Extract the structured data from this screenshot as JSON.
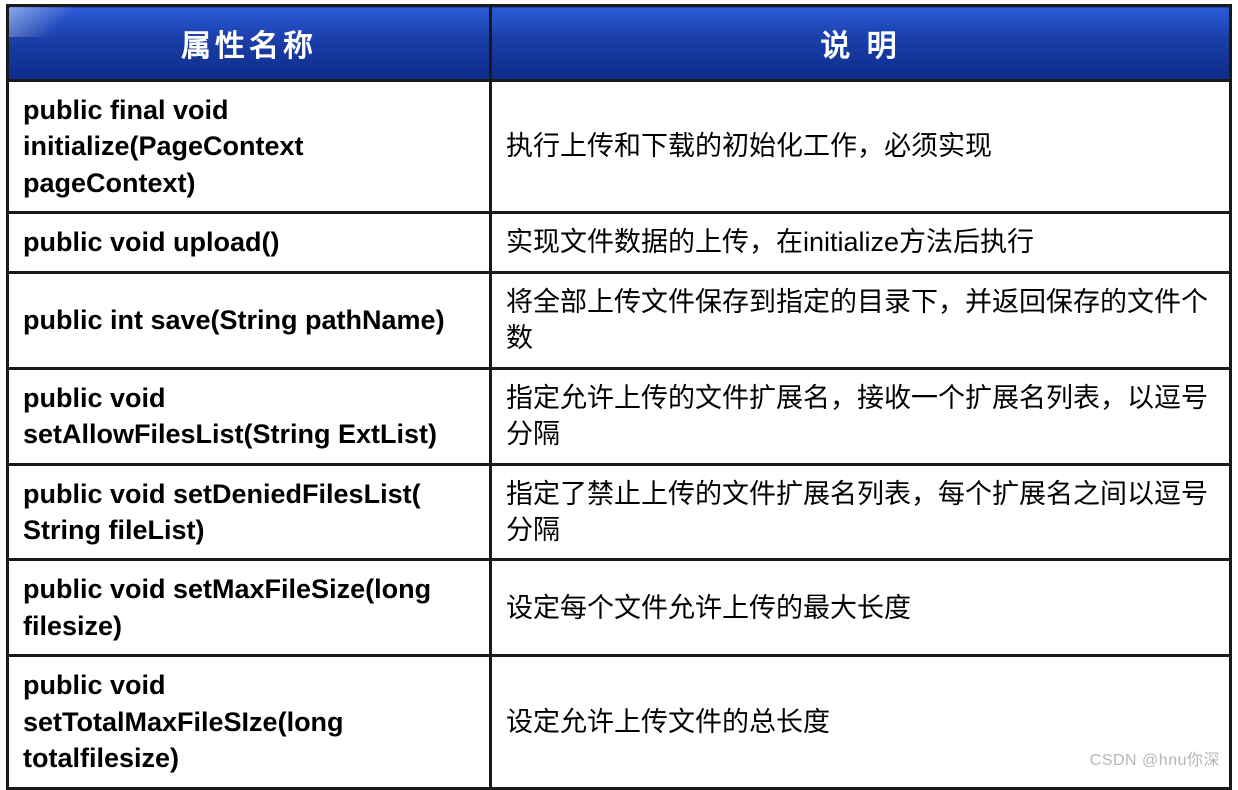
{
  "headers": {
    "name": "属性名称",
    "desc": "说   明"
  },
  "rows": [
    {
      "name": "public final void initialize(PageContext pageContext)",
      "desc": "执行上传和下载的初始化工作，必须实现"
    },
    {
      "name": "public void upload()",
      "desc": "实现文件数据的上传，在initialize方法后执行"
    },
    {
      "name": "public int save(String pathName)",
      "desc": "将全部上传文件保存到指定的目录下，并返回保存的文件个数"
    },
    {
      "name": "public void setAllowFilesList(String ExtList)",
      "desc": "指定允许上传的文件扩展名，接收一个扩展名列表，以逗号分隔"
    },
    {
      "name": "public void setDeniedFilesList( String   fileList)",
      "desc": "指定了禁止上传的文件扩展名列表，每个扩展名之间以逗号分隔"
    },
    {
      "name": "public void setMaxFileSize(long filesize)",
      "desc": "设定每个文件允许上传的最大长度"
    },
    {
      "name": "public  void setTotalMaxFileSIze(long totalfilesize)",
      "desc": "设定允许上传文件的总长度"
    }
  ],
  "watermark": "CSDN @hnu你深"
}
